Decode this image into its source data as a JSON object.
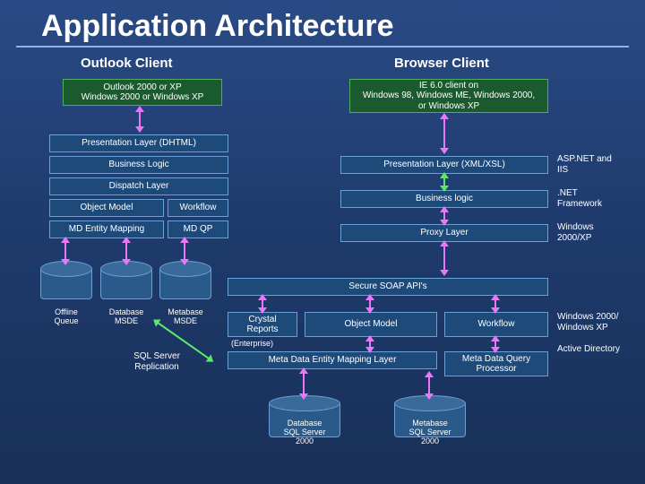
{
  "title": "Application Architecture",
  "left_header": "Outlook Client",
  "right_header": "Browser Client",
  "outlook_env": "Outlook 2000 or XP\nWindows 2000 or Windows XP",
  "ie_env": "IE 6.0 client on\nWindows 98, Windows ME, Windows 2000,\nor Windows XP",
  "pl_dhtml": "Presentation Layer (DHTML)",
  "business_logic": "Business Logic",
  "dispatch_layer": "Dispatch Layer",
  "object_model": "Object Model",
  "workflow": "Workflow",
  "md_entity_mapping": "MD Entity Mapping",
  "md_qp": "MD QP",
  "pl_xml": "Presentation Layer (XML/XSL)",
  "business_logic_r": "Business logic",
  "proxy_layer": "Proxy Layer",
  "offline_queue": "Offline\nQueue",
  "database_msde": "Database\nMSDE",
  "metabase_msde": "Metabase\nMSDE",
  "secure_soap": "Secure SOAP API's",
  "crystal_reports": "Crystal\nReports",
  "crystal_note": "(Enterprise)",
  "object_model_b": "Object Model",
  "workflow_b": "Workflow",
  "meta_data_entity": "Meta Data Entity Mapping Layer",
  "meta_data_query": "Meta Data Query\nProcessor",
  "sql_server_repl": "SQL Server\nReplication",
  "db_sql2000": "Database\nSQL Server\n2000",
  "mb_sql2000": "Metabase\nSQL Server\n2000",
  "note_asp": "ASP.NET and\nIIS",
  "note_net": ".NET\nFramework",
  "note_w2kxp": "Windows\n2000/XP",
  "note_w2kxp_ad": "Windows 2000/\nWindows XP\n\nActive Directory"
}
